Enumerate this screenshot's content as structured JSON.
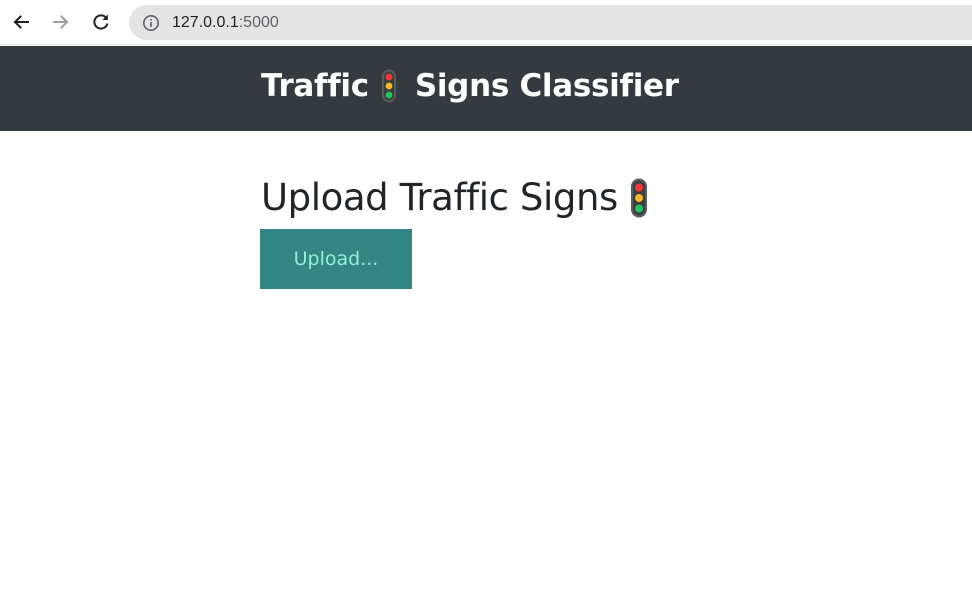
{
  "browser": {
    "url_host": "127.0.0.1",
    "url_port": ":5000",
    "icons": [
      "back-arrow-icon",
      "forward-arrow-icon",
      "reload-icon",
      "info-icon"
    ]
  },
  "navbar": {
    "brand_part1": "Traffic",
    "brand_part2": "Signs Classifier",
    "emoji_icon": "traffic-light-icon",
    "background": "#343a40"
  },
  "main": {
    "heading": "Upload Traffic Signs",
    "upload_label": "Upload...",
    "upload_bg": "#338683",
    "upload_text_color": "#8ff0d9"
  }
}
